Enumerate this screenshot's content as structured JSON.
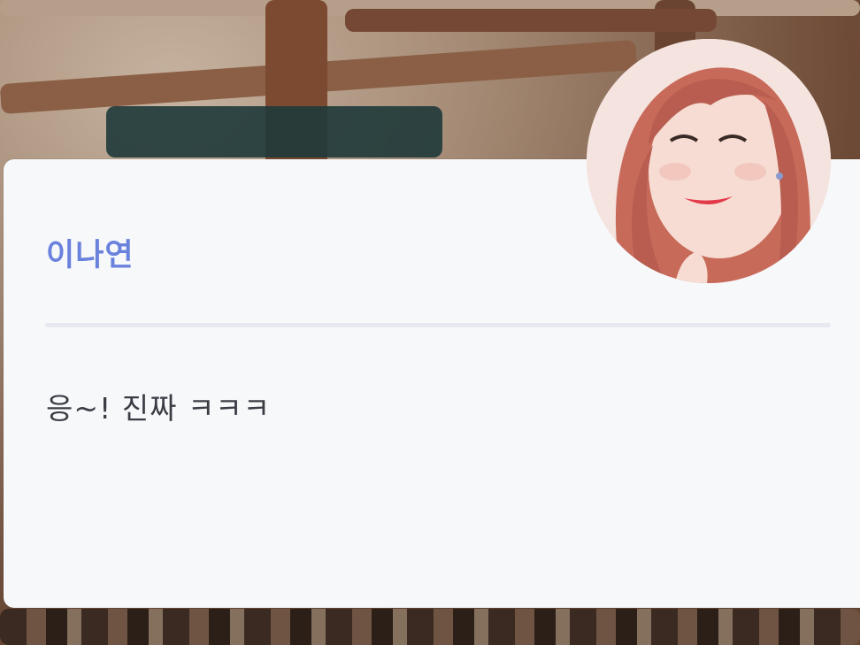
{
  "message_card": {
    "sender_name": "이나연",
    "message_text": "응~! 진짜 ㅋㅋㅋ"
  },
  "avatar": {
    "icon": "profile-photo"
  },
  "colors": {
    "sender_name": "#6a82dd",
    "card_background": "#f7f8fa",
    "divider": "#e6eaf0",
    "message_text": "#3a3d44"
  }
}
